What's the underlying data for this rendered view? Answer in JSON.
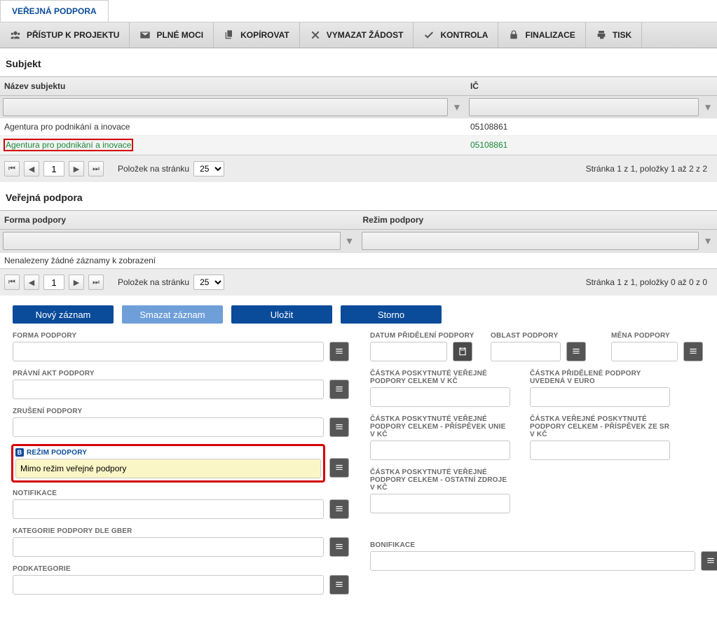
{
  "tab": {
    "label": "VEŘEJNÁ PODPORA"
  },
  "toolbar": {
    "access": "PŘÍSTUP K PROJEKTU",
    "full_powers": "PLNÉ MOCI",
    "copy": "KOPÍROVAT",
    "delete_request": "VYMAZAT ŽÁDOST",
    "check": "KONTROLA",
    "finalize": "FINALIZACE",
    "print": "TISK"
  },
  "subject": {
    "title": "Subjekt",
    "cols": {
      "name": "Název subjektu",
      "ic": "IČ"
    },
    "rows": [
      {
        "name": "Agentura pro podnikání a inovace",
        "ic": "05108861"
      },
      {
        "name": "Agentura pro podnikání a inovace",
        "ic": "05108861"
      }
    ],
    "pager": {
      "page": "1",
      "per_page_label": "Položek na stránku",
      "per_page": "25",
      "info": "Stránka 1 z 1, položky 1 až 2 z 2"
    }
  },
  "support": {
    "title": "Veřejná podpora",
    "cols": {
      "forma": "Forma podpory",
      "rezim": "Režim podpory"
    },
    "no_records": "Nenalezeny žádné záznamy k zobrazení",
    "pager": {
      "page": "1",
      "per_page_label": "Položek na stránku",
      "per_page": "25",
      "info": "Stránka 1 z 1, položky 0 až 0 z 0"
    }
  },
  "actions": {
    "new": "Nový záznam",
    "delete": "Smazat záznam",
    "save": "Uložit",
    "cancel": "Storno"
  },
  "form": {
    "forma_podpory": "FORMA PODPORY",
    "pravni_akt": "PRÁVNÍ AKT PODPORY",
    "zruseni": "ZRUŠENÍ PODPORY",
    "rezim": "REŽIM PODPORY",
    "rezim_value": "Mimo režim veřejné podpory",
    "notifikace": "NOTIFIKACE",
    "kategorie_gber": "KATEGORIE PODPORY DLE GBER",
    "podkategorie": "PODKATEGORIE",
    "datum_prideleni": "DATUM PŘIDĚLENÍ PODPORY",
    "oblast": "OBLAST PODPORY",
    "mena": "MĚNA PODPORY",
    "castka_celkem_kc": "ČÁSTKA POSKYTNUTÉ VEŘEJNÉ PODPORY CELKEM V KČ",
    "castka_prid_euro": "ČÁSTKA PŘIDĚLENÉ PODPORY UVEDENÁ V EURO",
    "castka_unie_kc": "ČÁSTKA POSKYTNUTÉ VEŘEJNÉ PODPORY CELKEM - PŘÍSPĚVEK UNIE V KČ",
    "castka_sr_kc": "ČÁSTKA VEŘEJNÉ POSKYTNUTÉ PODPORY CELKEM - PŘÍSPĚVEK ZE SR V KČ",
    "castka_ostatni_kc": "ČÁSTKA POSKYTNUTÉ VEŘEJNÉ PODPORY CELKEM - OSTATNÍ ZDROJE V KČ",
    "bonifikace": "BONIFIKACE"
  },
  "icons": {
    "filter": "▾"
  }
}
